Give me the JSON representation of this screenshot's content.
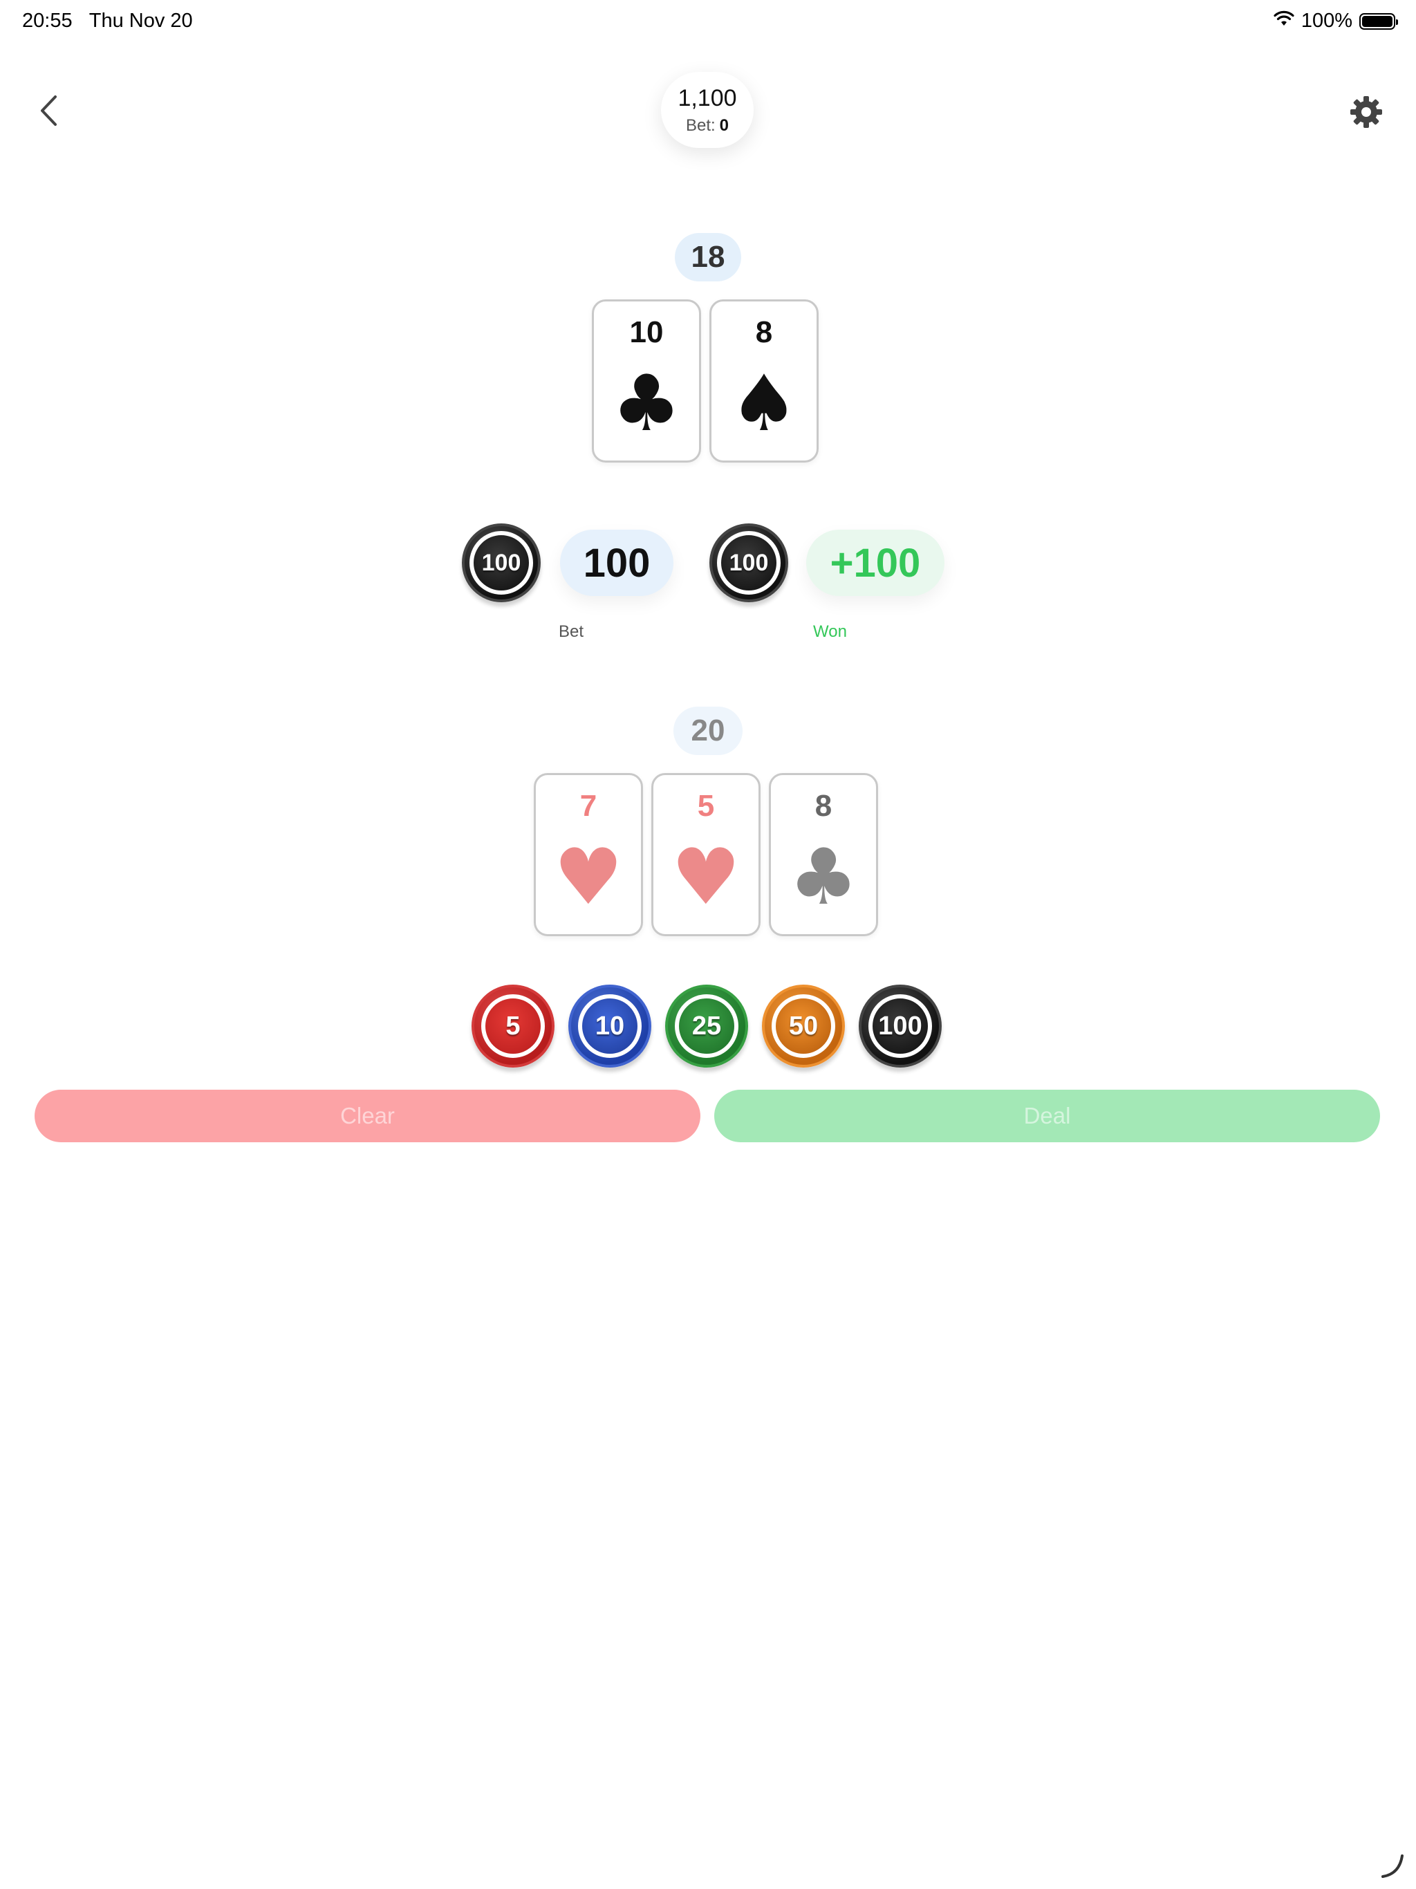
{
  "status_bar": {
    "time": "20:55",
    "date": "Thu Nov 20",
    "battery_percent": "100%"
  },
  "header": {
    "balance": "1,100",
    "bet_label": "Bet:",
    "bet_value": "0"
  },
  "dealer": {
    "score": "18",
    "cards": [
      {
        "rank": "10",
        "suit": "♣",
        "suit_name": "clubs"
      },
      {
        "rank": "8",
        "suit": "♠",
        "suit_name": "spades"
      }
    ]
  },
  "result": {
    "bet_chip": "100",
    "bet_amount": "100",
    "bet_label": "Bet",
    "won_chip": "100",
    "won_amount": "+100",
    "won_label": "Won"
  },
  "player": {
    "score": "20",
    "cards": [
      {
        "rank": "7",
        "suit": "♥",
        "suit_name": "hearts"
      },
      {
        "rank": "5",
        "suit": "♥",
        "suit_name": "hearts"
      },
      {
        "rank": "8",
        "suit": "♣",
        "suit_name": "clubs"
      }
    ]
  },
  "chips": [
    "5",
    "10",
    "25",
    "50",
    "100"
  ],
  "buttons": {
    "clear": "Clear",
    "deal": "Deal"
  },
  "colors": {
    "clear": "#fca3a6",
    "deal": "#a3e8b6",
    "won": "#34c759",
    "score_badge": "#e4f0fb"
  },
  "icons": [
    "back-chevron-icon",
    "gear-icon",
    "wifi-icon",
    "battery-icon"
  ]
}
